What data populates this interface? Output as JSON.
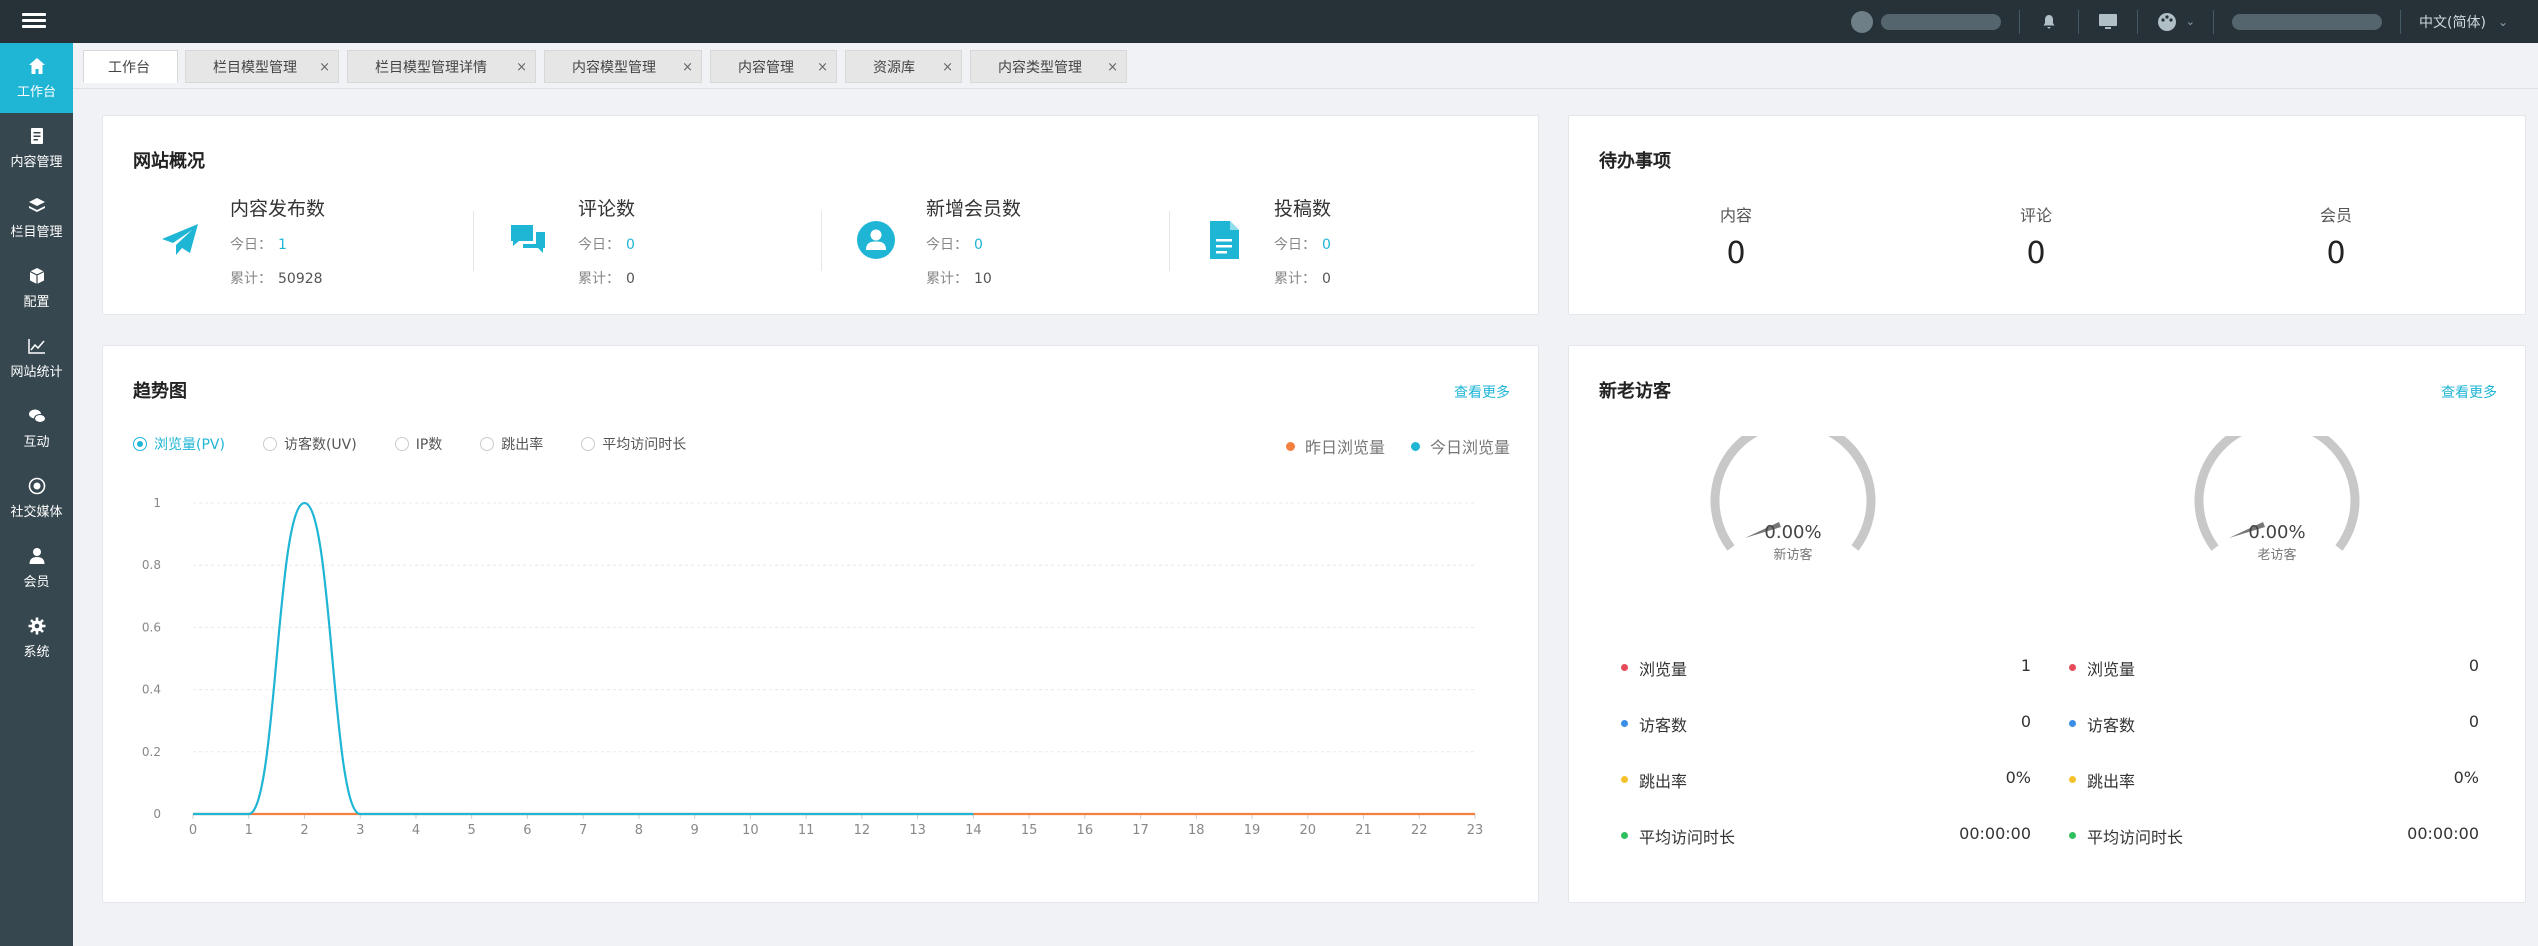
{
  "topbar": {
    "language": "中文(简体)"
  },
  "sidebar": {
    "items": [
      {
        "label": "工作台",
        "icon": "home-icon"
      },
      {
        "label": "内容管理",
        "icon": "document-icon"
      },
      {
        "label": "栏目管理",
        "icon": "layers-icon"
      },
      {
        "label": "配置",
        "icon": "box-icon"
      },
      {
        "label": "网站统计",
        "icon": "line-chart-icon"
      },
      {
        "label": "互动",
        "icon": "chat-icon"
      },
      {
        "label": "社交媒体",
        "icon": "target-icon"
      },
      {
        "label": "会员",
        "icon": "user-icon"
      },
      {
        "label": "系统",
        "icon": "gear-icon"
      }
    ]
  },
  "tabs": [
    {
      "label": "工作台",
      "closable": false
    },
    {
      "label": "栏目模型管理",
      "closable": true
    },
    {
      "label": "栏目模型管理详情",
      "closable": true
    },
    {
      "label": "内容模型管理",
      "closable": true
    },
    {
      "label": "内容管理",
      "closable": true
    },
    {
      "label": "资源库",
      "closable": true
    },
    {
      "label": "内容类型管理",
      "closable": true
    }
  ],
  "tab_close": "×",
  "overview": {
    "title": "网站概况",
    "today_label": "今日：",
    "total_label": "累计：",
    "stats": [
      {
        "name": "内容发布数",
        "today": "1",
        "total": "50928",
        "icon": "paper-plane-icon"
      },
      {
        "name": "评论数",
        "today": "0",
        "total": "0",
        "icon": "comments-icon"
      },
      {
        "name": "新增会员数",
        "today": "0",
        "total": "10",
        "icon": "member-icon"
      },
      {
        "name": "投稿数",
        "today": "0",
        "total": "0",
        "icon": "file-text-icon"
      }
    ]
  },
  "todo": {
    "title": "待办事项",
    "items": [
      {
        "label": "内容",
        "value": "0"
      },
      {
        "label": "评论",
        "value": "0"
      },
      {
        "label": "会员",
        "value": "0"
      }
    ]
  },
  "trend": {
    "title": "趋势图",
    "more": "查看更多",
    "metrics": [
      "浏览量(PV)",
      "访客数(UV)",
      "IP数",
      "跳出率",
      "平均访问时长"
    ],
    "selected_metric": 0,
    "legend": [
      "昨日浏览量",
      "今日浏览量"
    ]
  },
  "colors": {
    "accent": "#1fb5d5",
    "yesterday": "#f47f3e",
    "today": "#1fb5d5",
    "sidebar": "#37474f",
    "topbar": "#263238"
  },
  "chart_data": {
    "type": "line",
    "x": [
      0,
      1,
      2,
      3,
      4,
      5,
      6,
      7,
      8,
      9,
      10,
      11,
      12,
      13,
      14,
      15,
      16,
      17,
      18,
      19,
      20,
      21,
      22,
      23
    ],
    "ylim": [
      0,
      1
    ],
    "yticks": [
      0,
      0.2,
      0.4,
      0.6,
      0.8,
      1
    ],
    "grid": true,
    "legend_position": "top-right",
    "series": [
      {
        "name": "今日浏览量",
        "values": [
          0,
          0,
          1,
          0,
          0,
          0,
          0,
          0,
          0,
          0,
          0,
          0,
          0,
          0,
          0
        ],
        "color": "#1fb5d5"
      },
      {
        "name": "昨日浏览量",
        "values": [
          0,
          0,
          0,
          0,
          0,
          0,
          0,
          0,
          0,
          0,
          0,
          0,
          0,
          0,
          0,
          0,
          0,
          0,
          0,
          0,
          0,
          0,
          0,
          0
        ],
        "color": "#f47f3e"
      }
    ]
  },
  "visitors": {
    "title": "新老访客",
    "more": "查看更多",
    "gauges": [
      {
        "percent": "0.00%",
        "label": "新访客",
        "value": 0
      },
      {
        "percent": "0.00%",
        "label": "老访客",
        "value": 0
      }
    ],
    "new": [
      {
        "label": "浏览量",
        "value": "1",
        "color": "#e74c5b"
      },
      {
        "label": "访客数",
        "value": "0",
        "color": "#3a8ee6"
      },
      {
        "label": "跳出率",
        "value": "0%",
        "color": "#f5c12b"
      },
      {
        "label": "平均访问时长",
        "value": "00:00:00",
        "color": "#2fbf5e"
      }
    ],
    "old": [
      {
        "label": "浏览量",
        "value": "0",
        "color": "#e74c5b"
      },
      {
        "label": "访客数",
        "value": "0",
        "color": "#3a8ee6"
      },
      {
        "label": "跳出率",
        "value": "0%",
        "color": "#f5c12b"
      },
      {
        "label": "平均访问时长",
        "value": "00:00:00",
        "color": "#2fbf5e"
      }
    ]
  }
}
